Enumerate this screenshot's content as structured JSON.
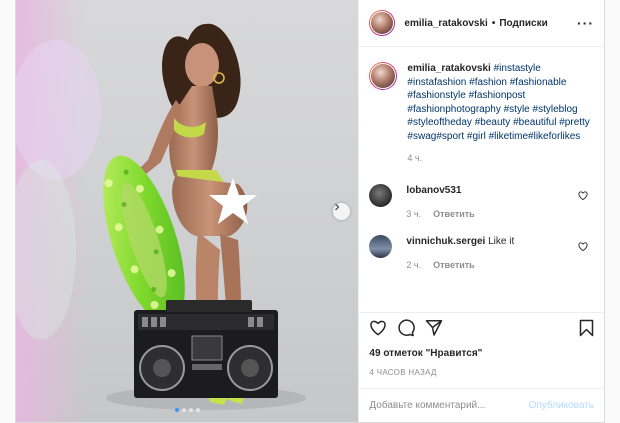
{
  "header": {
    "username": "emilia_ratakovski",
    "separator": "•",
    "follow_label": "Подписки",
    "more_label": "···"
  },
  "caption": {
    "username": "emilia_ratakovski",
    "hashtags": [
      "#instastyle",
      "#instafashion",
      "#fashion",
      "#fashionable",
      "#fashionstyle",
      "#fashionpost",
      "#fashionphotography",
      "#style",
      "#styleblog",
      "#styleoftheday",
      "#beauty",
      "#beautiful",
      "#pretty",
      "#swag#sport",
      "#girl",
      "#liketime#likeforlikes"
    ],
    "time": "4 ч."
  },
  "comments": [
    {
      "username": "lobanov531",
      "text": "ᅠᅠᅠ",
      "time": "3 ч.",
      "reply_label": "Ответить"
    },
    {
      "username": "vinnichuk.sergei",
      "text": "Like it",
      "time": "2 ч.",
      "reply_label": "Ответить"
    }
  ],
  "likes_text": "49 отметок \"Нравится\"",
  "time_ago": "4 ЧАСОВ НАЗАД",
  "add_comment": {
    "placeholder": "Добавьте комментарий...",
    "publish_label": "Опубликовать"
  },
  "carousel": {
    "slide_count": 4,
    "active_index": 0
  },
  "colors": {
    "link": "#003569",
    "publish_disabled": "#b3dbff",
    "secondary": "#8e8e8e",
    "active_dot": "#3897f0"
  },
  "icons": {
    "like": "heart-icon",
    "comment": "comment-bubble-icon",
    "share": "paper-plane-icon",
    "save": "bookmark-icon",
    "next": "chevron-right-icon",
    "comment_like": "small-heart-icon"
  }
}
